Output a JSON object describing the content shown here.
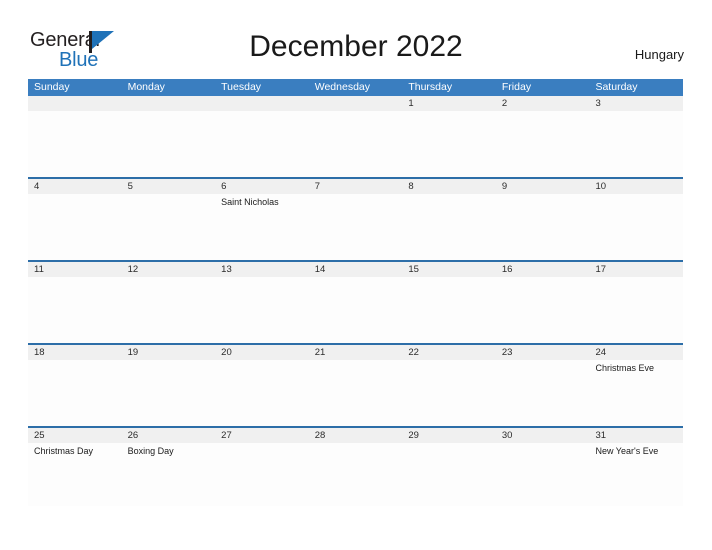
{
  "brand": {
    "name_part1": "General",
    "name_part2": "Blue",
    "flag_icon": "flag-icon",
    "color_dark": "#231f20",
    "color_blue": "#1f72b8"
  },
  "header": {
    "title": "December 2022",
    "country": "Hungary"
  },
  "theme": {
    "header_blue": "#3a7ec0",
    "rule_blue": "#2d6ea8",
    "number_band": "#f0f0f0",
    "cell_background": "#fdfdfd"
  },
  "calendar": {
    "month": "December",
    "year": "2022",
    "weekdays": [
      "Sunday",
      "Monday",
      "Tuesday",
      "Wednesday",
      "Thursday",
      "Friday",
      "Saturday"
    ],
    "weeks": [
      {
        "days": [
          {
            "num": "",
            "event": ""
          },
          {
            "num": "",
            "event": ""
          },
          {
            "num": "",
            "event": ""
          },
          {
            "num": "",
            "event": ""
          },
          {
            "num": "1",
            "event": ""
          },
          {
            "num": "2",
            "event": ""
          },
          {
            "num": "3",
            "event": ""
          }
        ]
      },
      {
        "days": [
          {
            "num": "4",
            "event": ""
          },
          {
            "num": "5",
            "event": ""
          },
          {
            "num": "6",
            "event": "Saint Nicholas"
          },
          {
            "num": "7",
            "event": ""
          },
          {
            "num": "8",
            "event": ""
          },
          {
            "num": "9",
            "event": ""
          },
          {
            "num": "10",
            "event": ""
          }
        ]
      },
      {
        "days": [
          {
            "num": "11",
            "event": ""
          },
          {
            "num": "12",
            "event": ""
          },
          {
            "num": "13",
            "event": ""
          },
          {
            "num": "14",
            "event": ""
          },
          {
            "num": "15",
            "event": ""
          },
          {
            "num": "16",
            "event": ""
          },
          {
            "num": "17",
            "event": ""
          }
        ]
      },
      {
        "days": [
          {
            "num": "18",
            "event": ""
          },
          {
            "num": "19",
            "event": ""
          },
          {
            "num": "20",
            "event": ""
          },
          {
            "num": "21",
            "event": ""
          },
          {
            "num": "22",
            "event": ""
          },
          {
            "num": "23",
            "event": ""
          },
          {
            "num": "24",
            "event": "Christmas Eve"
          }
        ]
      },
      {
        "days": [
          {
            "num": "25",
            "event": "Christmas Day"
          },
          {
            "num": "26",
            "event": "Boxing Day"
          },
          {
            "num": "27",
            "event": ""
          },
          {
            "num": "28",
            "event": ""
          },
          {
            "num": "29",
            "event": ""
          },
          {
            "num": "30",
            "event": ""
          },
          {
            "num": "31",
            "event": "New Year's Eve"
          }
        ]
      }
    ]
  }
}
